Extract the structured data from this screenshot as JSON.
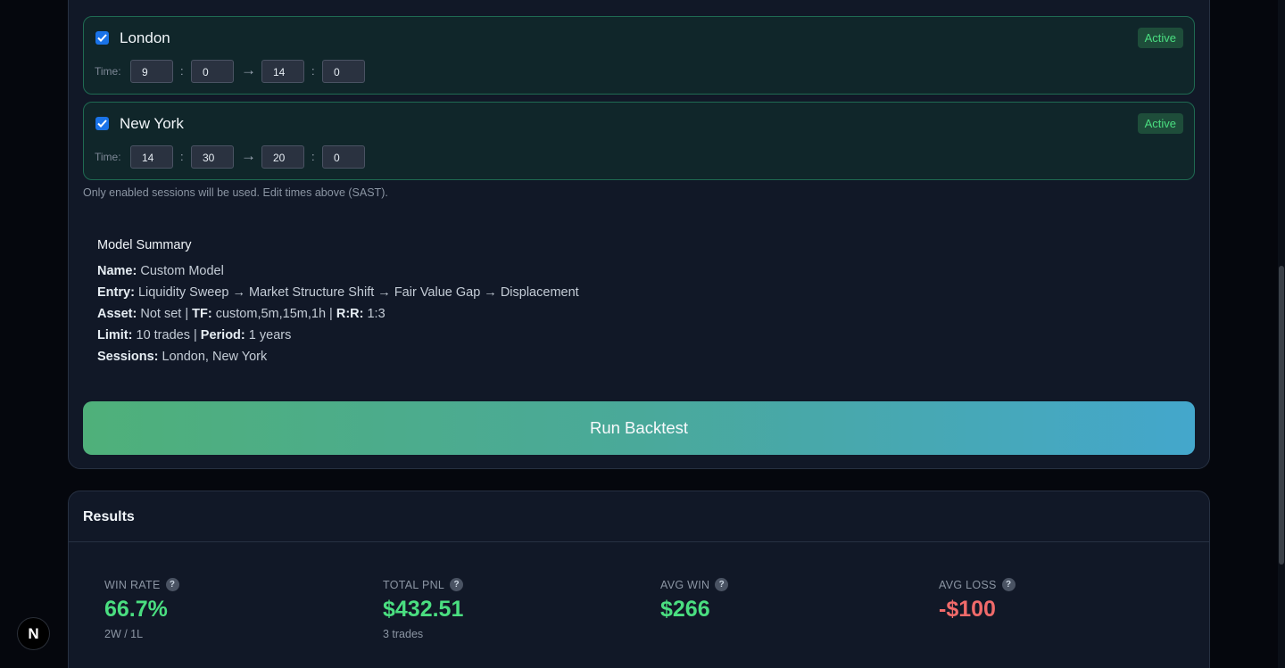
{
  "sessions": [
    {
      "name": "London",
      "badge": "Active",
      "time_label": "Time:",
      "start_h": "9",
      "start_m": "0",
      "end_h": "14",
      "end_m": "0"
    },
    {
      "name": "New York",
      "badge": "Active",
      "time_label": "Time:",
      "start_h": "14",
      "start_m": "30",
      "end_h": "20",
      "end_m": "0"
    }
  ],
  "time_sep": ":",
  "time_arrow": "→",
  "hint": "Only enabled sessions will be used. Edit times above (SAST).",
  "summary": {
    "title": "Model Summary",
    "name_k": "Name:",
    "name_v": "Custom Model",
    "entry_k": "Entry:",
    "entry_v": "Liquidity Sweep → Market Structure Shift → Fair Value Gap → Displacement",
    "asset_k": "Asset:",
    "asset_v": "Not set |",
    "tf_k": "TF:",
    "tf_v": "custom,5m,15m,1h |",
    "rr_k": "R:R:",
    "rr_v": "1:3",
    "limit_k": "Limit:",
    "limit_v": "10 trades |",
    "period_k": "Period:",
    "period_v": "1 years",
    "sessions_k": "Sessions:",
    "sessions_v": "London, New York"
  },
  "run_button": "Run Backtest",
  "results": {
    "title": "Results",
    "stats": [
      {
        "label": "WIN RATE",
        "value": "66.7%",
        "sub": "2W / 1L",
        "color": "#4ade80"
      },
      {
        "label": "TOTAL PNL",
        "value": "$432.51",
        "sub": "3 trades",
        "color": "#4ade80"
      },
      {
        "label": "AVG WIN",
        "value": "$266",
        "sub": "",
        "color": "#4ade80"
      },
      {
        "label": "AVG LOSS",
        "value": "-$100",
        "sub": "",
        "color": "#f06a6a"
      }
    ]
  },
  "help_glyph": "?",
  "framework_badge": "N"
}
